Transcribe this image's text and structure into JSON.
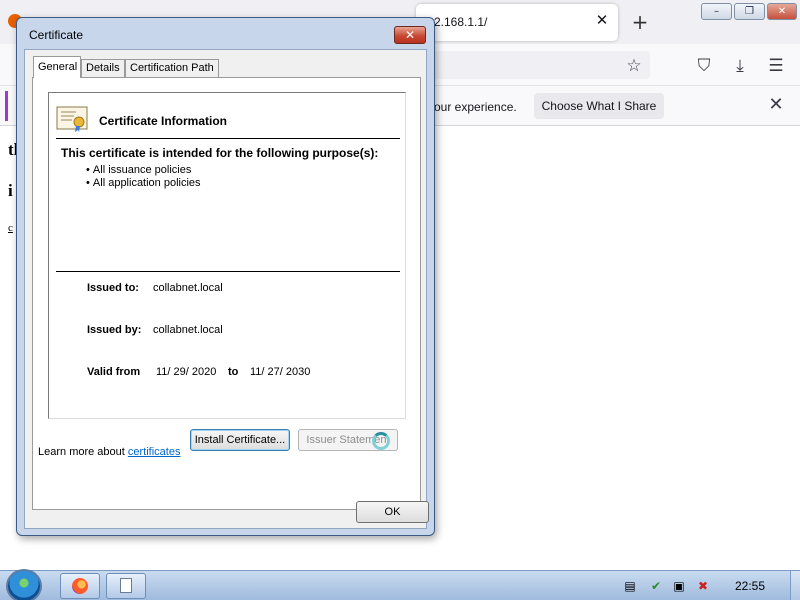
{
  "browser": {
    "tab_title": "2.168.1.1/",
    "tab_close_glyph": "✕",
    "new_tab_glyph": "+",
    "window_controls": [
      "–",
      "❐",
      "✕"
    ],
    "nav_icons": [
      "star-icon",
      "pocket-icon",
      "download-icon",
      "menu-icon"
    ],
    "notice_text": "our experience.",
    "notice_button": "Choose What I Share",
    "notice_close_glyph": "✕",
    "page_snippets": [
      "th",
      "i",
      "c"
    ]
  },
  "dialog": {
    "title": "Certificate",
    "close_glyph": "✕",
    "tabs": [
      "General",
      "Details",
      "Certification Path"
    ],
    "info_heading": "Certificate Information",
    "purpose_heading": "This certificate is intended for the following purpose(s):",
    "purposes": [
      "All issuance policies",
      "All application policies"
    ],
    "issued_to_label": "Issued to:",
    "issued_to": "collabnet.local",
    "issued_by_label": "Issued by:",
    "issued_by": "collabnet.local",
    "valid_from_label": "Valid from",
    "valid_from": "11/ 29/ 2020",
    "valid_to_label": "to",
    "valid_to": "11/ 27/ 2030",
    "install_button": "Install Certificate...",
    "issuer_statement_button": "Issuer Statement",
    "learn_more_prefix": "Learn more about",
    "learn_more_link": "certificates",
    "ok_button": "OK"
  },
  "taskbar": {
    "clock": "22:55",
    "tray_icons": [
      "notes-icon",
      "security-shield-icon",
      "network-icon",
      "volume-muted-icon"
    ]
  }
}
